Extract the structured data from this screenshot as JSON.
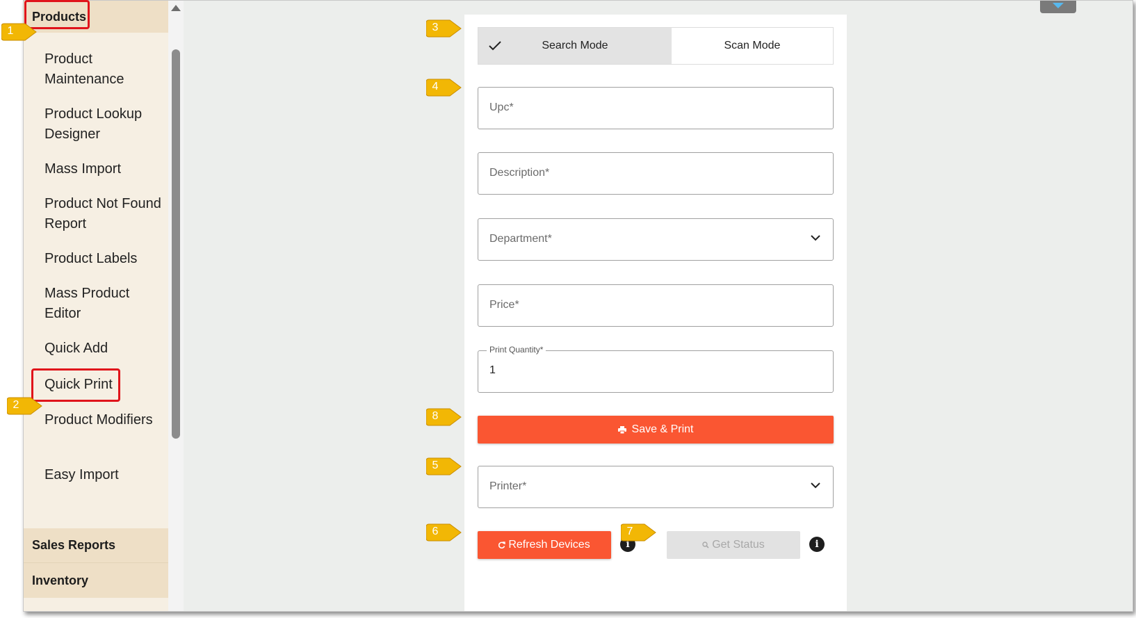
{
  "sidebar": {
    "section_products": "Products",
    "items": [
      {
        "label": "Product Maintenance"
      },
      {
        "label": "Product Lookup Designer"
      },
      {
        "label": "Mass Import"
      },
      {
        "label": "Product Not Found Report"
      },
      {
        "label": "Product Labels"
      },
      {
        "label": "Mass Product Editor"
      },
      {
        "label": "Quick Add"
      },
      {
        "label": "Quick Print"
      },
      {
        "label": "Product Modifiers"
      },
      {
        "label": "Easy Import"
      }
    ],
    "section_sales": "Sales Reports",
    "section_inventory": "Inventory"
  },
  "mode_toggle": {
    "search_label": "Search Mode",
    "scan_label": "Scan Mode",
    "selected": "Search Mode"
  },
  "form": {
    "upc_label": "Upc*",
    "description_label": "Description*",
    "department_label": "Department*",
    "price_label": "Price*",
    "print_quantity_label": "Print Quantity*",
    "print_quantity_value": "1",
    "printer_label": "Printer*"
  },
  "buttons": {
    "save_print": "Save & Print",
    "refresh_devices": "Refresh Devices",
    "get_status": "Get Status"
  },
  "annotations": {
    "callouts": [
      "1",
      "2",
      "3",
      "4",
      "5",
      "6",
      "7",
      "8"
    ],
    "callout_color": "#f2b705",
    "highlight_color": "#e0141b"
  },
  "colors": {
    "accent": "#fa5632",
    "sidebar_bg": "#f6efe3",
    "sidebar_header_bg": "#eedfc6"
  },
  "info_icon_glyph": "i"
}
